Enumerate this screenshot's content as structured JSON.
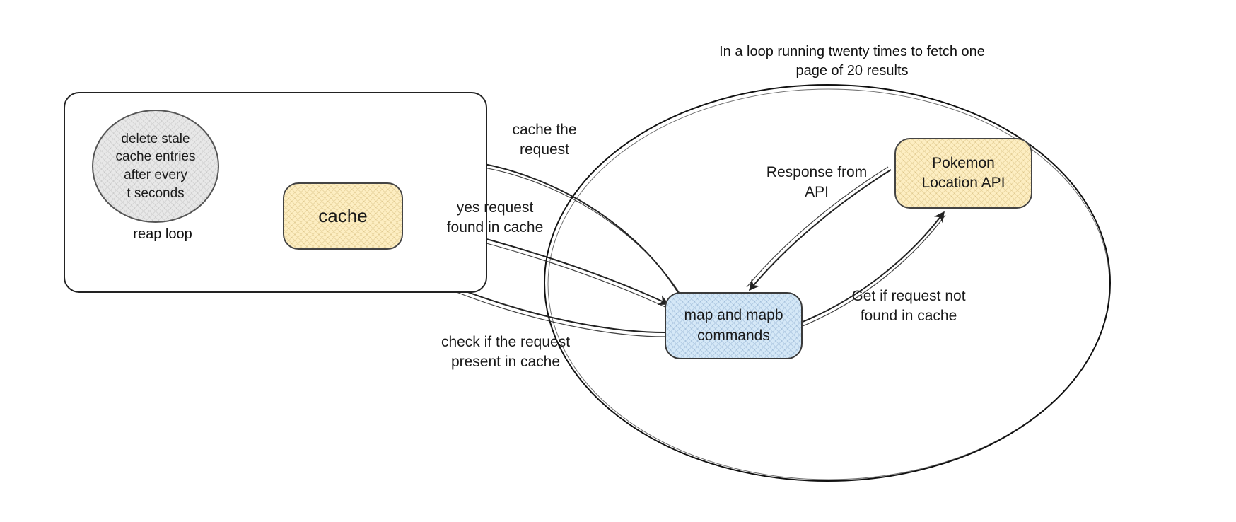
{
  "loop_caption": "In a loop running twenty times to fetch one\npage of 20 results",
  "reap": {
    "text": "delete stale\ncache entries\nafter every\nt seconds",
    "label": "reap loop"
  },
  "cache": {
    "label": "cache"
  },
  "commands": {
    "label": "map and mapb\ncommands"
  },
  "api": {
    "label": "Pokemon\nLocation API"
  },
  "edges": {
    "cache_the_request": "cache the\nrequest",
    "yes_found": "yes request\nfound in cache",
    "check_present": "check if the request\npresent in cache",
    "get_if_not_found": "Get if request not\nfound in cache",
    "response_from_api": "Response from\nAPI"
  }
}
